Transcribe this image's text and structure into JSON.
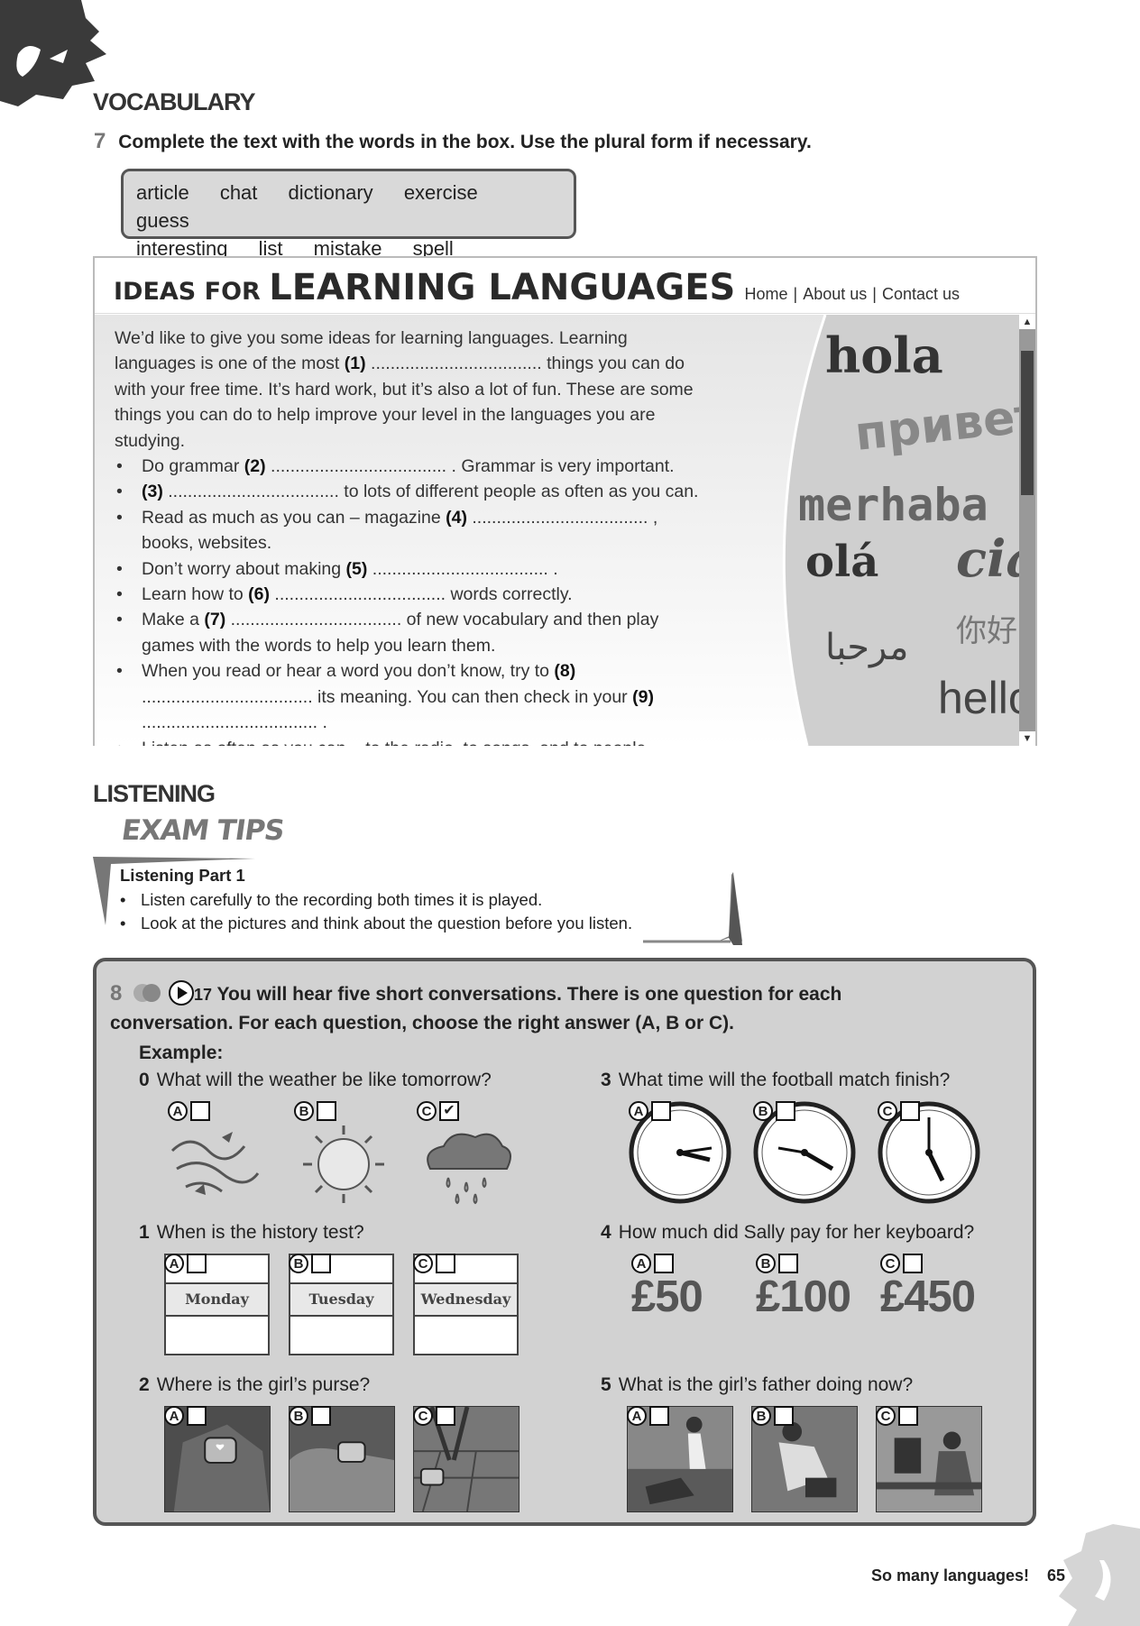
{
  "sections": {
    "vocabulary": "VOCABULARY",
    "listening": "LISTENING"
  },
  "q7": {
    "number": "7",
    "instruction": "Complete the text with the words in the box. Use the plural form if necessary."
  },
  "wordbox": {
    "line1": [
      "article",
      "chat",
      "dictionary",
      "exercise",
      "guess"
    ],
    "line2": [
      "interesting",
      "list",
      "mistake",
      "spell"
    ]
  },
  "website": {
    "title_small": "IDEAS FOR ",
    "title_big": "LEARNING LANGUAGES",
    "nav": [
      "Home",
      "About us",
      "Contact us"
    ],
    "intro": "We’d like to give you some ideas for learning languages. Learning languages is one of the most",
    "intro_gap": "(1)",
    "intro_cont": "................................... things you can do with your free time. It’s hard work, but it’s also a lot of fun. These are some things you can do to help improve your level in the languages you are studying.",
    "bullets": [
      {
        "pre": "Do grammar ",
        "gap": "(2)",
        "post": " .................................... . Grammar is very important."
      },
      {
        "pre": "",
        "gap": "(3)",
        "post": " ................................... to lots of different people as often as you can."
      },
      {
        "pre": "Read as much as you can – magazine ",
        "gap": "(4)",
        "post": " .................................... , books, websites."
      },
      {
        "pre": "Don’t worry about making ",
        "gap": "(5)",
        "post": " .................................... ."
      },
      {
        "pre": "Learn how to ",
        "gap": "(6)",
        "post": " ................................... words correctly."
      },
      {
        "pre": "Make a ",
        "gap": "(7)",
        "post": " ................................... of new vocabulary and then play games with the words to help you learn them."
      },
      {
        "pre": "When you read or hear a word you don’t know, try to ",
        "gap": "(8)",
        "post": " ................................... its meaning. You can then check in your "
      },
      {
        "pre": "Listen as often as you can – to the radio, to songs, and to people talking.",
        "gap": "",
        "post": ""
      }
    ],
    "gap9": "(9)",
    "gap9_post": " .................................... .",
    "greetings": [
      "hola",
      "привет",
      "merhaba",
      "olá",
      "ciao",
      "مرحبا",
      "你好",
      "hello"
    ]
  },
  "exam_tips": {
    "header": "EXAM TIPS",
    "title": "Listening Part 1",
    "tips": [
      "Listen carefully to the recording both times it is played.",
      "Look at the pictures and think about the question before you listen."
    ]
  },
  "q8": {
    "number": "8",
    "track": "17",
    "instruction": "You will hear five short conversations. There is one question for each conversation. For each question, choose the right answer (A, B or C).",
    "example_label": "Example:",
    "questions": [
      {
        "n": "0",
        "text": "What will the weather be like tomorrow?"
      },
      {
        "n": "1",
        "text": "When is the history test?"
      },
      {
        "n": "2",
        "text": "Where is the girl’s purse?"
      },
      {
        "n": "3",
        "text": "What time will the football match finish?"
      },
      {
        "n": "4",
        "text": "How much did Sally pay for her keyboard?"
      },
      {
        "n": "5",
        "text": "What is the girl’s father doing now?"
      }
    ],
    "option_letters": [
      "A",
      "B",
      "C"
    ],
    "check": "✔",
    "days": [
      "Monday",
      "Tuesday",
      "Wednesday"
    ],
    "prices": [
      "£50",
      "£100",
      "£450"
    ]
  },
  "footer": {
    "unit": "So many languages!",
    "page": "65"
  }
}
